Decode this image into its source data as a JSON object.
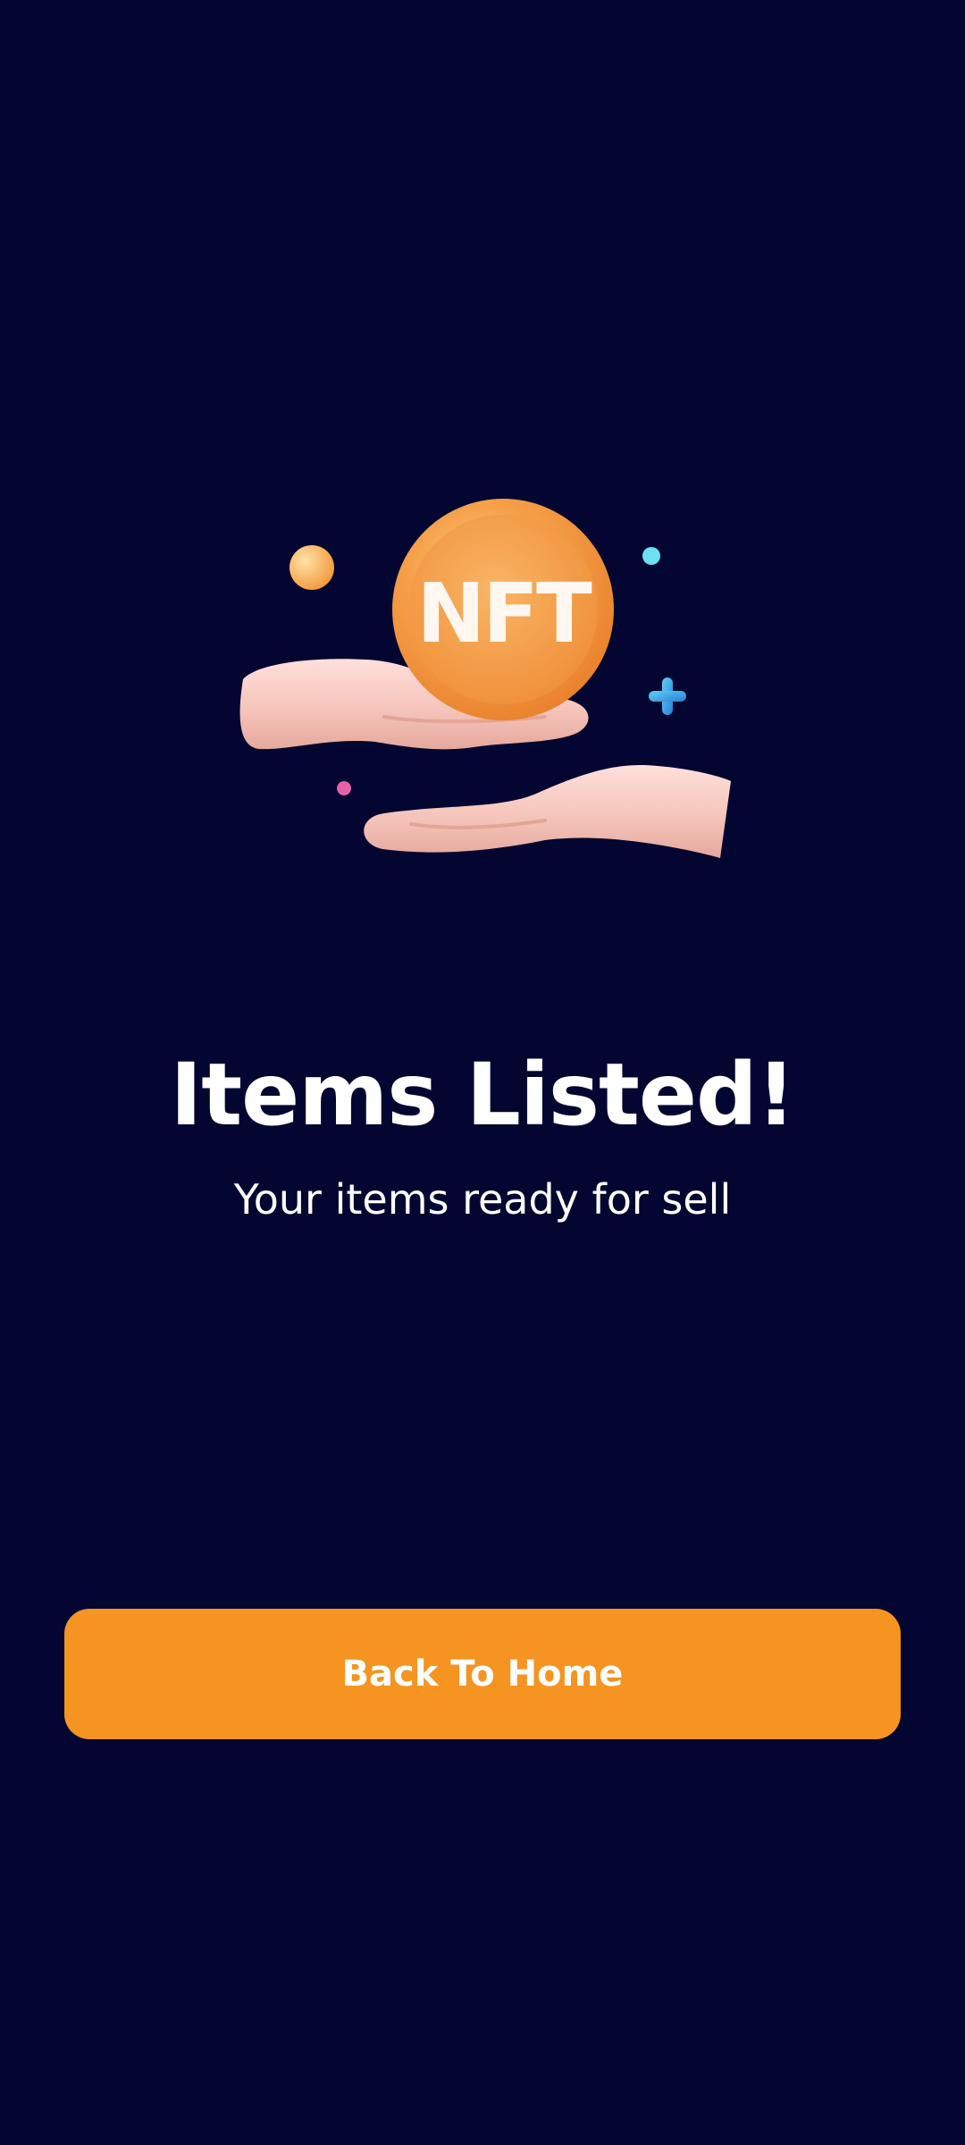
{
  "screen": {
    "title": "Items Listed!",
    "subtitle": "Your items ready for sell"
  },
  "illustration": {
    "coin_text": "NFT",
    "icons": [
      "nft-coin-icon",
      "open-hand-icon",
      "receiving-hand-icon",
      "plus-sparkle-icon",
      "dot-sparkle-icon"
    ]
  },
  "actions": {
    "back_home_label": "Back To Home"
  },
  "colors": {
    "background": "#030631",
    "accent": "#f59420",
    "text": "#ffffff",
    "coin": "#f39a3c",
    "hand": "#f3c4bb",
    "sparkle_blue": "#3aa6e8",
    "sparkle_cyan": "#6be1f2",
    "sparkle_pink": "#e561a8"
  }
}
